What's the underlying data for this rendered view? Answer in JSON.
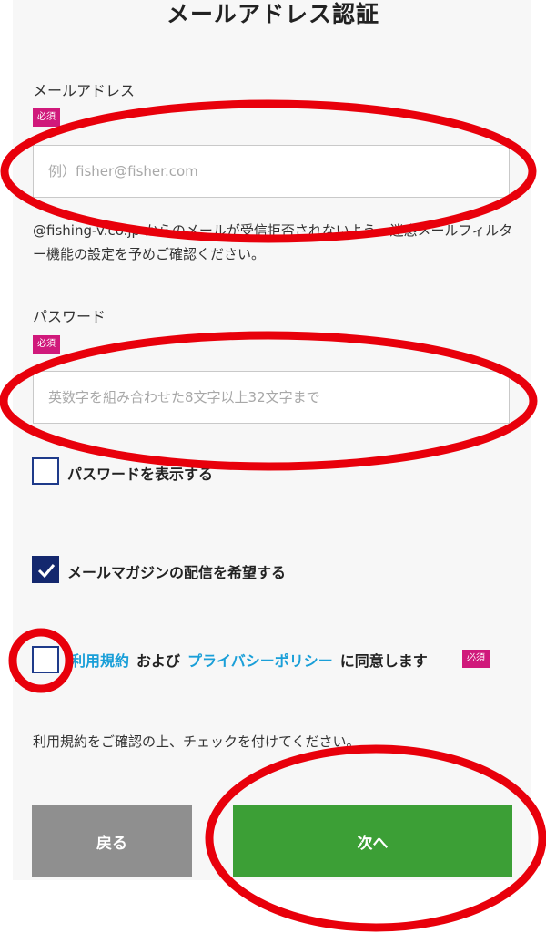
{
  "page": {
    "title": "メールアドレス認証"
  },
  "email": {
    "label": "メールアドレス",
    "required_badge": "必須",
    "placeholder": "例）fisher@fisher.com",
    "value": ""
  },
  "email_note": "@fishing-v.co.jp からのメールが受信拒否されないよう、迷惑メールフィルター機能の設定を予めご確認ください。",
  "password": {
    "label": "パスワード",
    "required_badge": "必須",
    "placeholder": "英数字を組み合わせた8文字以上32文字まで",
    "value": ""
  },
  "show_password": {
    "label": "パスワードを表示する",
    "checked": false
  },
  "newsletter": {
    "label": "メールマガジンの配信を希望する",
    "checked": true
  },
  "terms": {
    "link1": "利用規約",
    "text1": "および",
    "link2": "プライバシーポリシー",
    "text2": "に同意します",
    "required_badge": "必須",
    "checked": false
  },
  "terms_note": "利用規約をご確認の上、チェックを付けてください。",
  "buttons": {
    "back": "戻る",
    "next": "次へ"
  },
  "annotation": {
    "color": "#e8000b"
  },
  "colors": {
    "required": "#d0197b",
    "link": "#1a9fd8",
    "next": "#3c9f36",
    "back": "#8f8f8f",
    "checkbox": "#14286e"
  }
}
